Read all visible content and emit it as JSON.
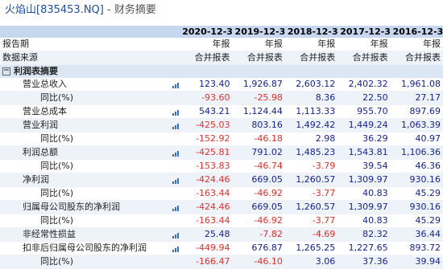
{
  "header": {
    "stock": "火焰山[835453.NQ]",
    "separator": " - ",
    "page_title": "财务摘要"
  },
  "years": [
    "2020-12-31",
    "2019-12-31",
    "2018-12-31",
    "2017-12-31",
    "2016-12-31"
  ],
  "meta_rows": [
    {
      "label": "报告期",
      "values": [
        "年报",
        "年报",
        "年报",
        "年报",
        "年报"
      ]
    },
    {
      "label": "数据来源",
      "values": [
        "合并报表",
        "合并报表",
        "合并报表",
        "合并报表",
        "合并报表"
      ]
    }
  ],
  "section": {
    "toggle": "⊟",
    "label": "利润表摘要"
  },
  "rows": [
    {
      "label": "营业总收入",
      "indent": 1,
      "chart": true,
      "values": [
        "123.40",
        "1,926.87",
        "2,603.12",
        "2,402.32",
        "1,961.08"
      ],
      "signs": [
        "pos",
        "pos",
        "pos",
        "pos",
        "pos"
      ]
    },
    {
      "label": "同比(%)",
      "indent": 2,
      "chart": false,
      "values": [
        "-93.60",
        "-25.98",
        "8.36",
        "22.50",
        "27.17"
      ],
      "signs": [
        "neg",
        "neg",
        "pos",
        "pos",
        "pos"
      ]
    },
    {
      "label": "营业总成本",
      "indent": 1,
      "chart": true,
      "values": [
        "543.21",
        "1,124.44",
        "1,113.33",
        "955.70",
        "897.69"
      ],
      "signs": [
        "pos",
        "pos",
        "pos",
        "pos",
        "pos"
      ]
    },
    {
      "label": "营业利润",
      "indent": 1,
      "chart": true,
      "values": [
        "-425.03",
        "803.16",
        "1,492.42",
        "1,449.24",
        "1,063.39"
      ],
      "signs": [
        "neg",
        "pos",
        "pos",
        "pos",
        "pos"
      ]
    },
    {
      "label": "同比(%)",
      "indent": 2,
      "chart": false,
      "values": [
        "-152.92",
        "-46.18",
        "2.98",
        "36.29",
        "40.97"
      ],
      "signs": [
        "neg",
        "neg",
        "pos",
        "pos",
        "pos"
      ]
    },
    {
      "label": "利润总额",
      "indent": 1,
      "chart": true,
      "values": [
        "-425.81",
        "791.02",
        "1,485.23",
        "1,543.81",
        "1,106.36"
      ],
      "signs": [
        "neg",
        "pos",
        "pos",
        "pos",
        "pos"
      ]
    },
    {
      "label": "同比(%)",
      "indent": 2,
      "chart": false,
      "values": [
        "-153.83",
        "-46.74",
        "-3.79",
        "39.54",
        "46.36"
      ],
      "signs": [
        "neg",
        "neg",
        "neg",
        "pos",
        "pos"
      ]
    },
    {
      "label": "净利润",
      "indent": 1,
      "chart": true,
      "values": [
        "-424.46",
        "669.05",
        "1,260.57",
        "1,309.97",
        "930.16"
      ],
      "signs": [
        "neg",
        "pos",
        "pos",
        "pos",
        "pos"
      ]
    },
    {
      "label": "同比(%)",
      "indent": 2,
      "chart": false,
      "values": [
        "-163.44",
        "-46.92",
        "-3.77",
        "40.83",
        "45.29"
      ],
      "signs": [
        "neg",
        "neg",
        "neg",
        "pos",
        "pos"
      ]
    },
    {
      "label": "归属母公司股东的净利润",
      "indent": 1,
      "chart": true,
      "values": [
        "-424.46",
        "669.05",
        "1,260.57",
        "1,309.97",
        "930.16"
      ],
      "signs": [
        "neg",
        "pos",
        "pos",
        "pos",
        "pos"
      ]
    },
    {
      "label": "同比(%)",
      "indent": 2,
      "chart": false,
      "values": [
        "-163.44",
        "-46.92",
        "-3.77",
        "40.83",
        "45.29"
      ],
      "signs": [
        "neg",
        "neg",
        "neg",
        "pos",
        "pos"
      ]
    },
    {
      "label": "非经常性损益",
      "indent": 1,
      "chart": true,
      "values": [
        "25.48",
        "-7.82",
        "-4.69",
        "82.32",
        "36.44"
      ],
      "signs": [
        "pos",
        "neg",
        "neg",
        "pos",
        "pos"
      ]
    },
    {
      "label": "扣非后归属母公司股东的净利润",
      "indent": 1,
      "chart": true,
      "values": [
        "-449.94",
        "676.87",
        "1,265.25",
        "1,227.65",
        "893.72"
      ],
      "signs": [
        "neg",
        "pos",
        "pos",
        "pos",
        "pos"
      ]
    },
    {
      "label": "同比(%)",
      "indent": 2,
      "chart": false,
      "values": [
        "-166.47",
        "-46.10",
        "3.06",
        "37.36",
        "39.94"
      ],
      "signs": [
        "neg",
        "neg",
        "pos",
        "pos",
        "pos"
      ]
    }
  ],
  "colors": {
    "header_bg": "#c6d7ef",
    "negative": "#e0312c",
    "positive": "#15248f",
    "icon": "#3a6fc4"
  },
  "icons": {
    "row_chart": "bar-chart-icon",
    "section_toggle": "collapse-icon"
  }
}
